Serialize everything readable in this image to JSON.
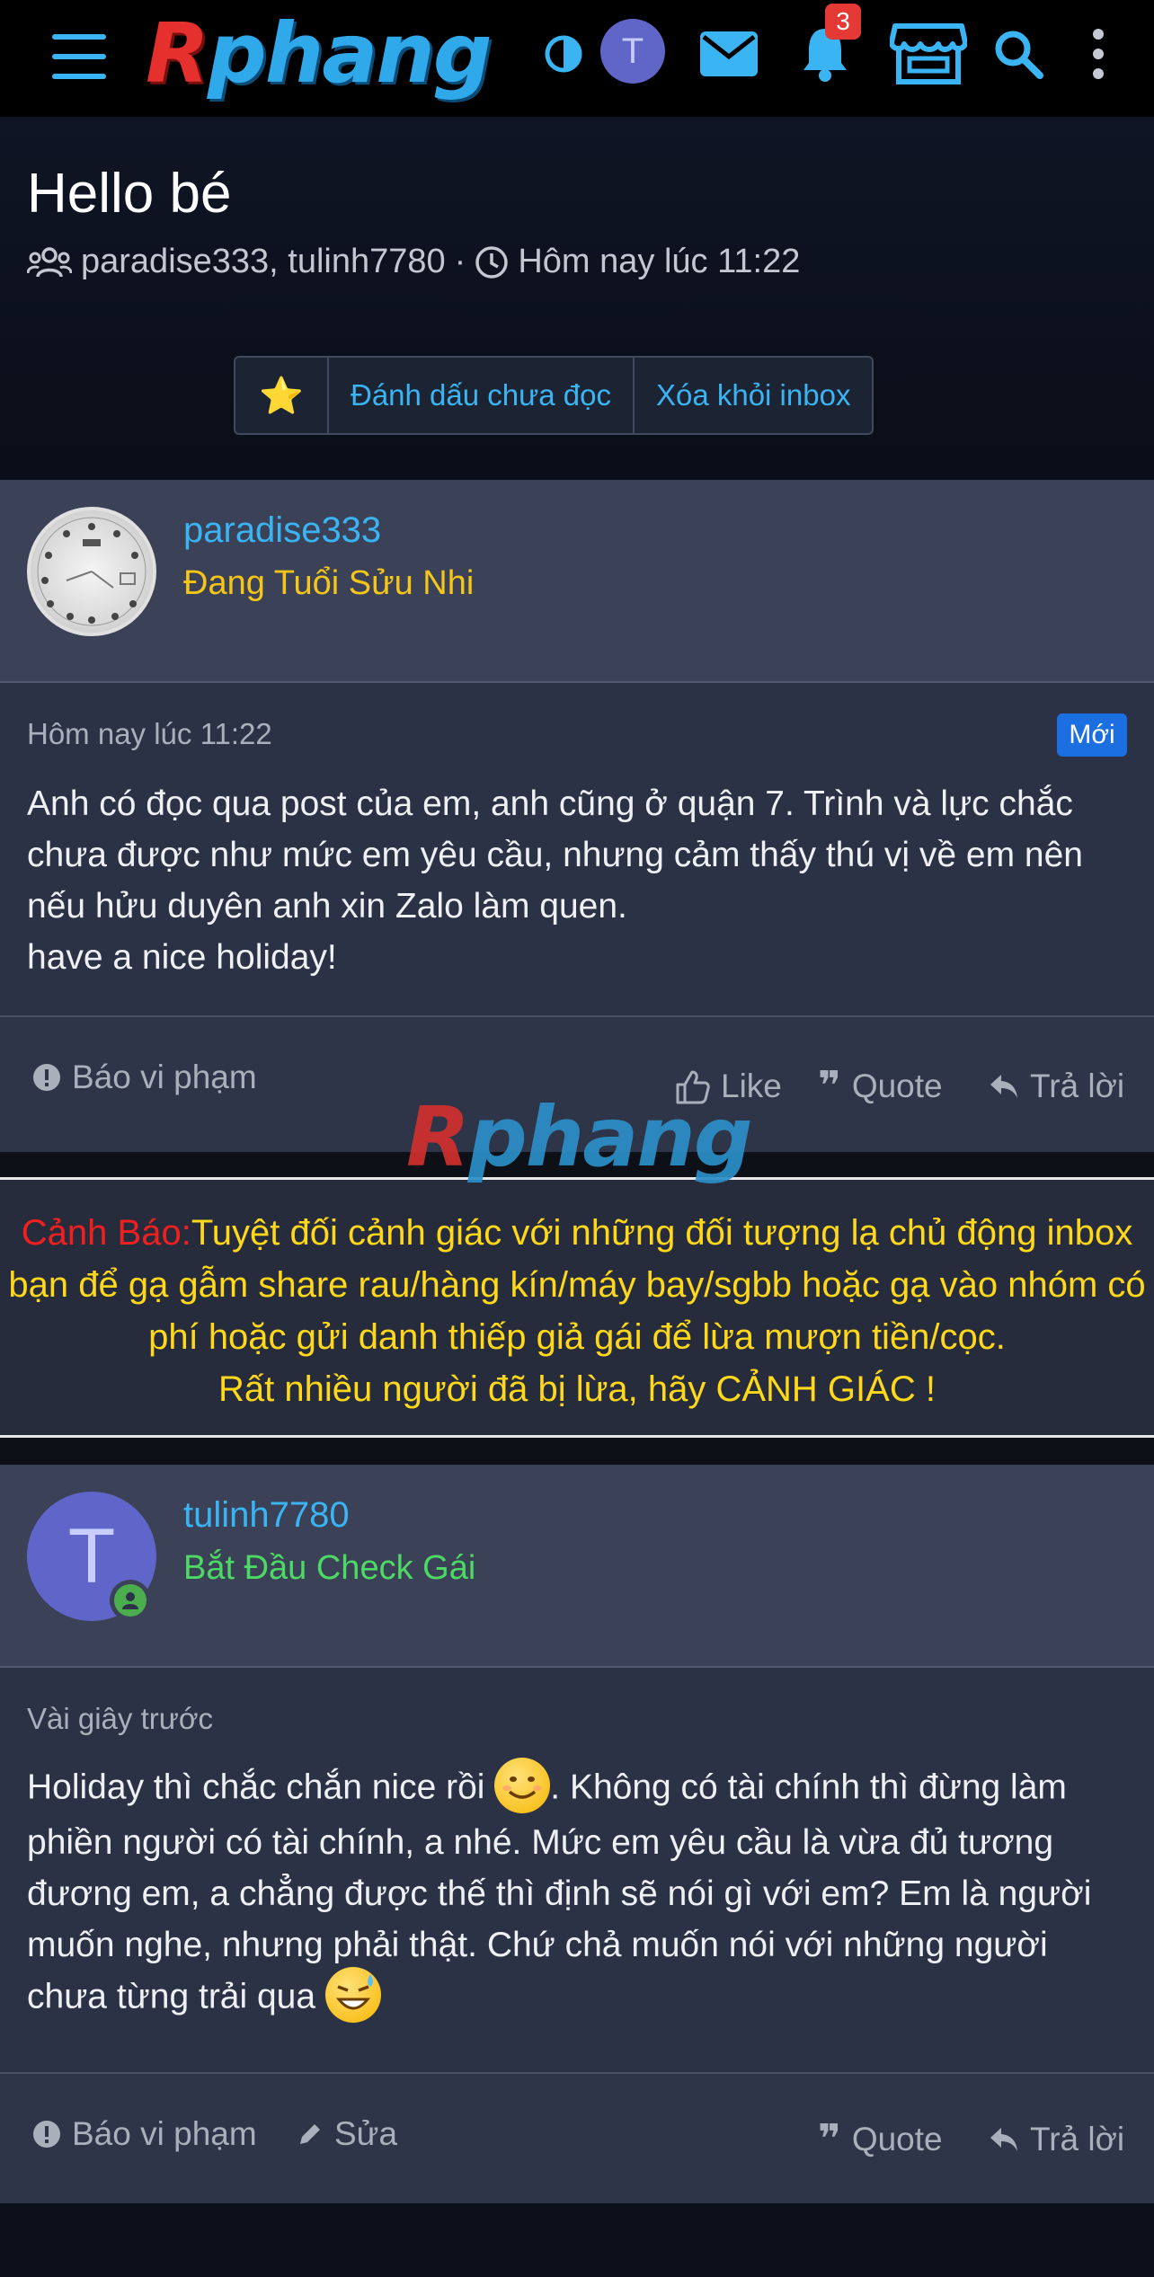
{
  "header": {
    "logo_r": "R",
    "logo_rest": "phang",
    "avatar_letter": "T",
    "notification_count": "3",
    "icons": [
      "menu-icon",
      "contrast-icon",
      "mail-icon",
      "bell-icon",
      "store-icon",
      "search-icon",
      "more-icon"
    ],
    "accent": "#3ab4f2"
  },
  "thread": {
    "title": "Hello bé",
    "participants": "paradise333, tulinh7780",
    "separator": "·",
    "time": "Hôm nay lúc 11:22",
    "star": "⭐",
    "mark_unread": "Đánh dấu chưa đọc",
    "remove_inbox": "Xóa khỏi inbox"
  },
  "messages": [
    {
      "username": "paradise333",
      "user_title": "Đang Tuổi Sửu Nhi",
      "user_title_color": "#f5c518",
      "time": "Hôm nay lúc 11:22",
      "new_badge": "Mới",
      "text": "Anh có đọc qua post của em, anh cũng ở quận 7. Trình và lực chắc chưa được như mức em yêu cầu, nhưng cảm thấy thú vị về em nên nếu hửu duyên anh xin Zalo làm quen.\nhave a nice holiday!",
      "report": "Báo vi phạm",
      "like": "Like",
      "quote": "Quote",
      "reply": "Trả lời"
    },
    {
      "username": "tulinh7780",
      "avatar_letter": "T",
      "user_title": "Bắt Đầu Check Gái",
      "user_title_color": "#4cd964",
      "time": "Vài giây trước",
      "text_part1": "Holiday thì chắc chắn nice rồi ",
      "text_part2": ". Không có tài chính thì đừng làm phiền người có tài chính, a nhé. Mức em yêu cầu là vừa đủ tương đương em, a chẳng được thế thì định sẽ nói gì với em? Em là người muốn nghe, nhưng phải thật. Chứ chả muốn nói với những người chưa từng trải qua ",
      "report": "Báo vi phạm",
      "edit": "Sửa",
      "quote": "Quote",
      "reply": "Trả lời"
    }
  ],
  "warning": {
    "label": "Cảnh Báo:",
    "line1": "Tuyệt đối cảnh giác với những đối tượng lạ chủ động inbox bạn để gạ gẫm share rau/hàng kín/máy bay/sgbb hoặc gạ vào nhóm có phí hoặc gửi danh thiếp giả gái để lừa mượn tiền/cọc.",
    "line2": "Rất nhiều người đã bị lừa, hãy CẢNH GIÁC !"
  },
  "watermark": {
    "r": "R",
    "rest": "phang"
  }
}
